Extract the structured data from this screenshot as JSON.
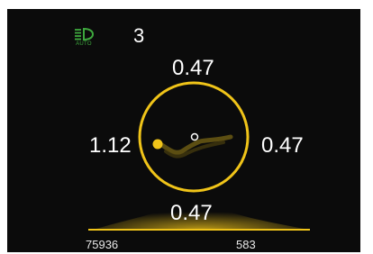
{
  "display": {
    "headlight_icon": "headlight-auto-icon",
    "headlight_mode": "AUTO",
    "gear": "3",
    "accent_color": "#f0c419",
    "indicator_color": "#3ea83e"
  },
  "gauge": {
    "top_value": "0.47",
    "left_value": "1.12",
    "right_value": "0.47",
    "bottom_value": "0.47"
  },
  "footer": {
    "odometer": "75936",
    "trip": "583"
  }
}
